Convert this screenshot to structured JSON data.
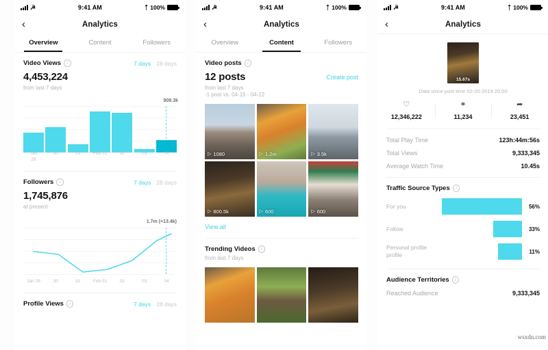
{
  "statusbar": {
    "time": "9:41 AM",
    "battery": "100%",
    "bluetooth_icon": "bluetooth-icon",
    "wifi_icon": "wifi-icon",
    "signal_icon": "signal-icon"
  },
  "nav": {
    "title": "Analytics",
    "back_icon": "back-chevron-icon"
  },
  "tabs": [
    {
      "label": "Overview"
    },
    {
      "label": "Content"
    },
    {
      "label": "Followers"
    }
  ],
  "colors": {
    "accent": "#3fd3ea",
    "bar": "#4fd9ec",
    "bar_highlight": "#05b8d4",
    "text": "#121212",
    "muted": "#b4b4b4"
  },
  "panel1": {
    "video_views": {
      "title": "Video Views",
      "range_7": "7 days",
      "range_28": "28 days",
      "value": "4,453,224",
      "caption": "from last 7 days",
      "peak_label": "909.3k"
    },
    "followers": {
      "title": "Followers",
      "range_7": "7 days",
      "range_28": "28 days",
      "value": "1,745,876",
      "caption": "at present",
      "peak_label": "1.7m (+13.4k)"
    },
    "profile_views": {
      "title": "Profile Views",
      "range_7": "7 days",
      "range_28": "28 days"
    }
  },
  "panel2": {
    "video_posts": {
      "title": "Video posts",
      "value": "12 posts",
      "create_post": "Create post",
      "caption": "from last 7 days",
      "compare": "-1 post vs. 04-15 - 04-22"
    },
    "videos": [
      {
        "views": "1080"
      },
      {
        "views": "1.2m"
      },
      {
        "views": "3.5k"
      },
      {
        "views": "800.5k"
      },
      {
        "views": "600"
      },
      {
        "views": "600"
      }
    ],
    "view_all": "View all",
    "trending": {
      "title": "Trending Videos",
      "caption": "from last 7 days"
    }
  },
  "panel3": {
    "thumb_duration": "15.67s",
    "since": "Data since post time 02-20-2019 20:00",
    "engagement": [
      {
        "icon": "heart-icon",
        "value": "12,346,222"
      },
      {
        "icon": "comment-icon",
        "value": "11,234"
      },
      {
        "icon": "share-icon",
        "value": "23,451"
      }
    ],
    "metrics": [
      {
        "key": "Total Play Time",
        "value": "123h:44m:56s"
      },
      {
        "key": "Total Views",
        "value": "9,333,345"
      },
      {
        "key": "Average Watch Time",
        "value": "10.45s"
      }
    ],
    "traffic": {
      "title": "Traffic Source Types",
      "rows": [
        {
          "label": "For you",
          "pct": "56%"
        },
        {
          "label": "Follow",
          "pct": "33%"
        },
        {
          "label": "Personal profile profile",
          "pct": "11%"
        }
      ]
    },
    "audience": {
      "title": "Audience Territories",
      "row_key": "Reached Audience",
      "row_value": "9,333,345"
    }
  },
  "watermark": "wsxdn.com",
  "chart_data": [
    {
      "type": "bar",
      "title": "Video Views",
      "categories": [
        "Jan 29",
        "30",
        "31",
        "Feb 01",
        "02",
        "03",
        "04"
      ],
      "values": [
        420,
        550,
        180,
        880,
        850,
        70,
        270
      ],
      "unit": "k",
      "highlight_index": 6,
      "annotation": "909.3k",
      "grid": true,
      "xlabel": "",
      "ylabel": "",
      "ylim": [
        0,
        1000
      ]
    },
    {
      "type": "line",
      "title": "Followers",
      "x": [
        "Jan 29",
        "30",
        "31",
        "Feb 01",
        "02",
        "03",
        "04"
      ],
      "values": [
        0.49,
        0.42,
        0.05,
        0.1,
        0.3,
        0.72,
        0.87
      ],
      "annotation": "1.7m (+13.4k)",
      "grid": true,
      "xlabel": "",
      "ylabel": "",
      "ylim": [
        0,
        1
      ]
    },
    {
      "type": "bar",
      "title": "Traffic Source Types",
      "orientation": "horizontal",
      "categories": [
        "For you",
        "Follow",
        "Personal profile profile"
      ],
      "values": [
        56,
        33,
        11
      ],
      "unit": "%",
      "xlabel": "",
      "ylabel": "",
      "ylim": [
        0,
        100
      ]
    }
  ]
}
